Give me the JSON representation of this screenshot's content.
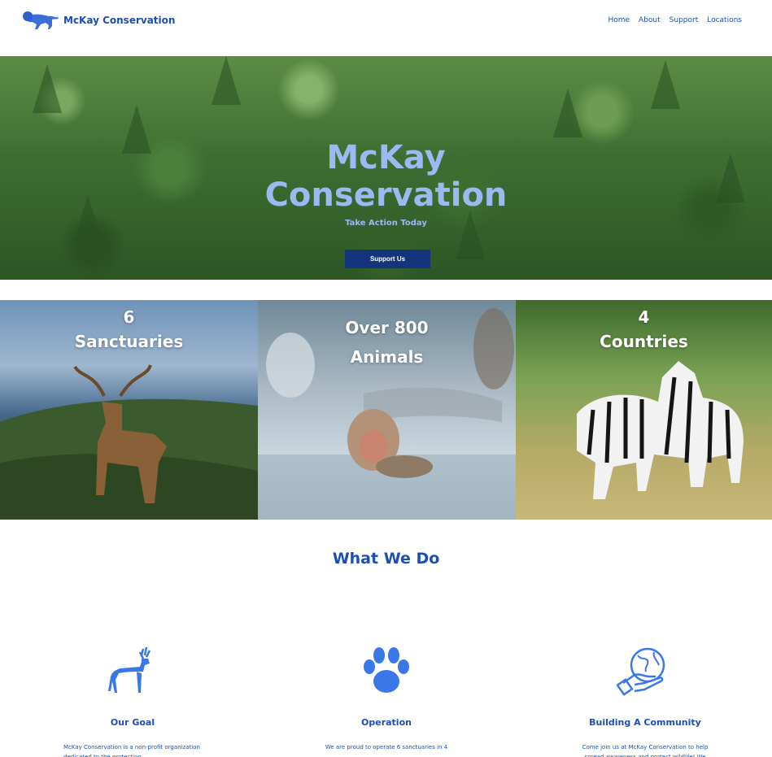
{
  "brand": {
    "name": "McKay Conservation",
    "logo_icon": "lion-icon",
    "color": "#1c4fb4"
  },
  "nav": {
    "items": [
      "Home",
      "About",
      "Support",
      "Locations"
    ]
  },
  "hero": {
    "title_line1": "McKay",
    "title_line2": "Conservation",
    "subtitle": "Take Action Today",
    "button_label": "Support Us",
    "button_color": "#15347e"
  },
  "stats": [
    {
      "line1": "6",
      "line2": "Sanctuaries",
      "image": "deer"
    },
    {
      "line1": "Over 800",
      "line2": "Animals",
      "image": "snow-monkey"
    },
    {
      "line1": "4",
      "line2": "Countries",
      "image": "zebras"
    }
  ],
  "what_we_do": {
    "title": "What We Do",
    "columns": [
      {
        "icon": "deer-icon",
        "title": "Our Goal",
        "text": "McKay Conservation is a non-profit organization dedicated to the protection"
      },
      {
        "icon": "paw-icon",
        "title": "Operation",
        "text": "We are proud to operate 6 sanctuaries in 4"
      },
      {
        "icon": "globe-hand-icon",
        "title": "Building A Community",
        "text": "Come join us at McKay Conservation to help spread awareness and protect wildlife! We"
      }
    ]
  }
}
